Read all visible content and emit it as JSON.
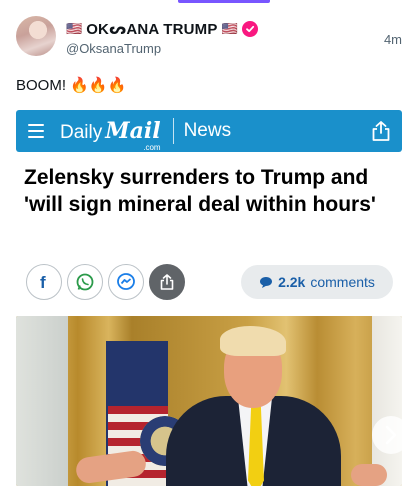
{
  "post": {
    "flag_left": "🇺🇸",
    "display_name": "OKᔕANA TRUMP",
    "flag_right": "🇺🇸",
    "handle": "@OksanaTrump",
    "timestamp": "4m",
    "text": "BOOM! 🔥🔥🔥",
    "verified_color": "#f91880"
  },
  "article": {
    "brand_daily": "Daily",
    "brand_mail": "Mail",
    "brand_com": ".com",
    "section": "News",
    "brand_color": "#1a90cb",
    "headline": "Zelensky surrenders to Trump and 'will sign mineral deal within hours'",
    "share_buttons": [
      "facebook-icon",
      "whatsapp-icon",
      "messenger-icon",
      "share-icon"
    ],
    "comments_count": "2.2k",
    "comments_label": "comments"
  },
  "icons": {
    "menu": "menu-icon",
    "share": "share-icon",
    "next": "chevron-right-icon"
  }
}
